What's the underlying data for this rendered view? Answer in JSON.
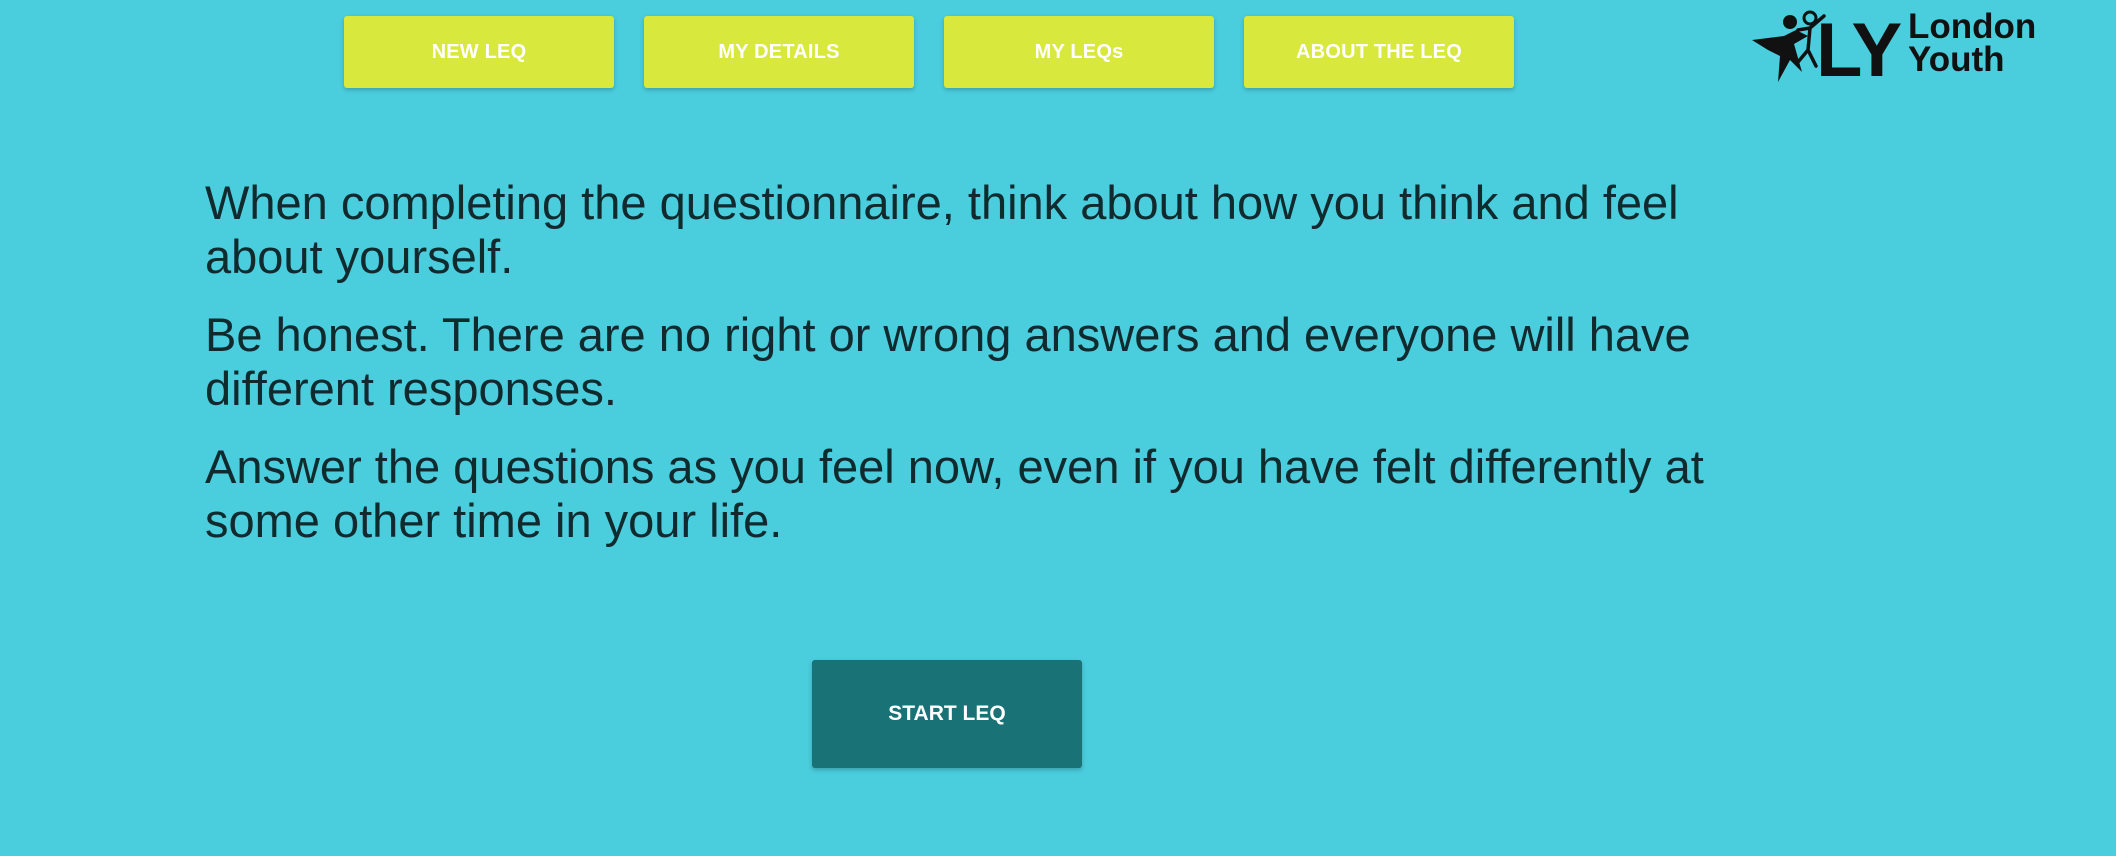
{
  "nav": {
    "items": [
      {
        "label": "NEW LEQ"
      },
      {
        "label": "MY DETAILS"
      },
      {
        "label": "MY LEQs"
      },
      {
        "label": "ABOUT THE LEQ"
      }
    ]
  },
  "logo": {
    "mark": "LY",
    "line1": "London",
    "line2": "Youth"
  },
  "intro": {
    "paragraphs": [
      "When completing the questionnaire, think about how you think and feel about yourself.",
      "Be honest. There are no right or wrong answers and everyone will have different responses.",
      "Answer the questions as you feel now, even if you have felt differently at some other time in your life."
    ]
  },
  "actions": {
    "start_label": "START LEQ"
  },
  "colors": {
    "background": "#4acddd",
    "nav_button": "#d8e83c",
    "start_button": "#187276",
    "text": "#102a2e"
  }
}
